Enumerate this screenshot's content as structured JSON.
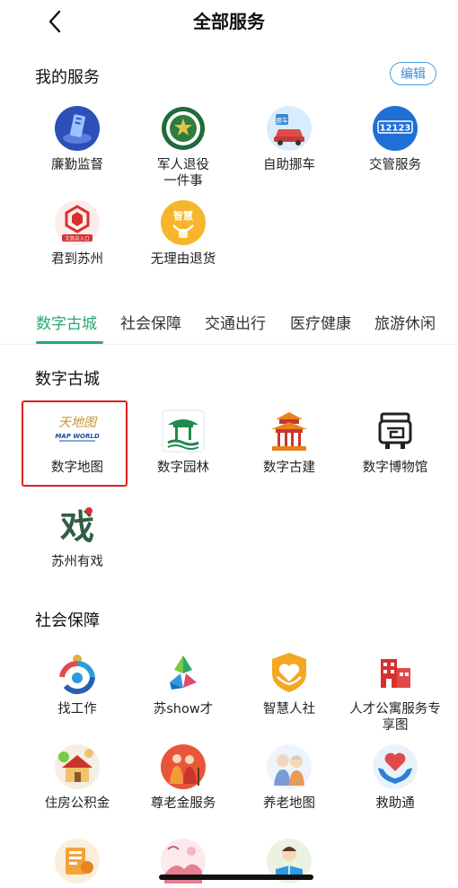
{
  "header": {
    "title": "全部服务",
    "back_icon": "chevron-left-icon"
  },
  "my_services": {
    "title": "我的服务",
    "edit_label": "编辑",
    "items": [
      {
        "label": "廉勤监督",
        "icon": "shield-badge-icon"
      },
      {
        "label": "军人退役\n一件事",
        "icon": "military-emblem-icon"
      },
      {
        "label": "自助挪车",
        "icon": "car-move-icon"
      },
      {
        "label": "交管服务",
        "icon": "traffic-12123-icon"
      },
      {
        "label": "君到苏州",
        "icon": "culture-tourism-icon"
      },
      {
        "label": "无理由退货",
        "icon": "smart-return-icon"
      }
    ],
    "icon_text": {
      "traffic": "12123",
      "smart": "智慧",
      "culture": "文旅总入口",
      "move": "挪车"
    }
  },
  "tabs": [
    {
      "label": "数字古城",
      "active": true
    },
    {
      "label": "社会保障",
      "active": false
    },
    {
      "label": "交通出行",
      "active": false
    },
    {
      "label": "医疗健康",
      "active": false
    },
    {
      "label": "旅游休闲",
      "active": false
    }
  ],
  "digital_city": {
    "title": "数字古城",
    "items": [
      {
        "label": "数字地图",
        "icon": "tianditu-map-icon"
      },
      {
        "label": "数字园林",
        "icon": "garden-pavilion-icon"
      },
      {
        "label": "数字古建",
        "icon": "ancient-building-icon"
      },
      {
        "label": "数字博物馆",
        "icon": "museum-icon"
      },
      {
        "label": "苏州有戏",
        "icon": "opera-xi-icon"
      }
    ],
    "icon_text": {
      "tianditu": "天地图",
      "mapworld": "MAP WORLD",
      "xi": "戏"
    }
  },
  "social_security": {
    "title": "社会保障",
    "items": [
      {
        "label": "找工作",
        "icon": "find-job-icon"
      },
      {
        "label": "苏show才",
        "icon": "talent-show-icon"
      },
      {
        "label": "智慧人社",
        "icon": "smart-social-icon"
      },
      {
        "label": "人才公寓服务专\n享图",
        "icon": "talent-apartment-icon"
      },
      {
        "label": "住房公积金",
        "icon": "housing-fund-icon"
      },
      {
        "label": "尊老金服务",
        "icon": "elderly-allowance-icon"
      },
      {
        "label": "养老地图",
        "icon": "elderly-map-icon"
      },
      {
        "label": "救助通",
        "icon": "relief-heart-icon"
      },
      {
        "label": "",
        "icon": "document-icon"
      },
      {
        "label": "",
        "icon": "scenery-icon"
      },
      {
        "label": "",
        "icon": "reading-child-icon"
      }
    ]
  },
  "colors": {
    "accent_green": "#2aa86f",
    "edit_blue": "#3d8fd6",
    "highlight_red": "#e02020"
  }
}
